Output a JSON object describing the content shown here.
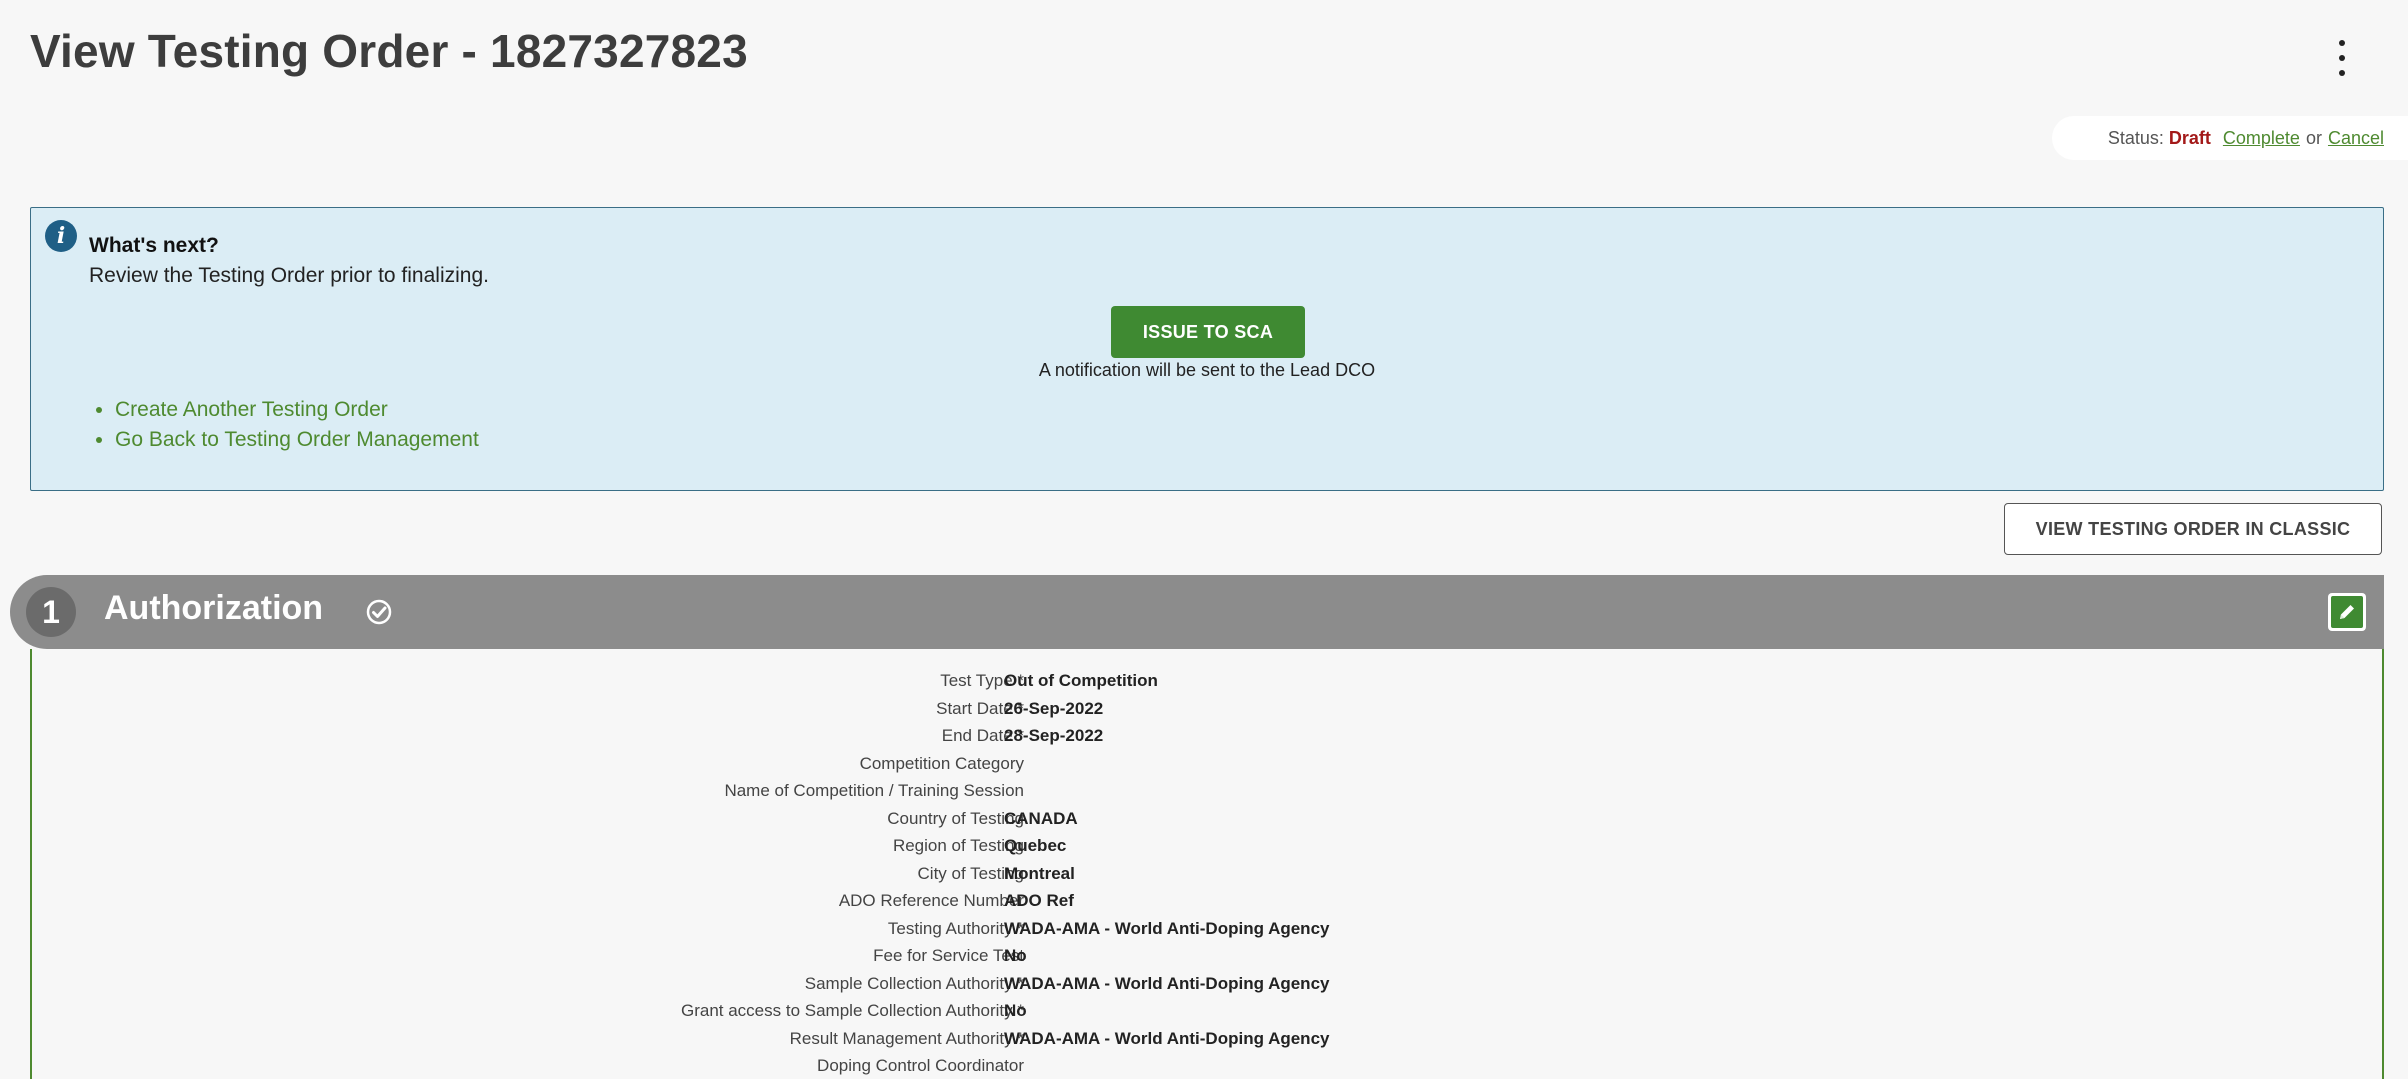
{
  "page": {
    "title": "View Testing Order - 1827327823"
  },
  "status": {
    "label": "Status:",
    "value": "Draft",
    "complete_link": "Complete",
    "or_text": "or",
    "cancel_link": "Cancel"
  },
  "info_panel": {
    "heading": "What's next?",
    "text": "Review the Testing Order prior to finalizing.",
    "issue_button": "ISSUE TO SCA",
    "notification": "A notification will be sent to the Lead DCO",
    "links": [
      "Create Another Testing Order",
      "Go Back to Testing Order Management"
    ]
  },
  "classic_button": "VIEW TESTING ORDER IN CLASSIC",
  "section": {
    "number": "1",
    "title": "Authorization",
    "fields": [
      {
        "label": "Test Type",
        "required": true,
        "value": "Out of Competition"
      },
      {
        "label": "Start Date",
        "required": true,
        "value": "26-Sep-2022"
      },
      {
        "label": "End Date",
        "required": true,
        "value": "28-Sep-2022"
      },
      {
        "label": "Competition Category",
        "required": false,
        "value": ""
      },
      {
        "label": "Name of Competition / Training Session",
        "required": false,
        "value": ""
      },
      {
        "label": "Country of Testing",
        "required": false,
        "value": "CANADA"
      },
      {
        "label": "Region of Testing",
        "required": false,
        "value": "Quebec"
      },
      {
        "label": "City of Testing",
        "required": false,
        "value": "Montreal"
      },
      {
        "label": "ADO Reference Number",
        "required": false,
        "value": "ADO Ref"
      },
      {
        "label": "Testing Authority",
        "required": true,
        "value": "WADA-AMA - World Anti-Doping Agency"
      },
      {
        "label": "Fee for Service Test",
        "required": false,
        "value": "No"
      },
      {
        "label": "Sample Collection Authority",
        "required": true,
        "value": "WADA-AMA - World Anti-Doping Agency"
      },
      {
        "label": "Grant access to Sample Collection Authority",
        "required": true,
        "value": "No"
      },
      {
        "label": "Result Management Authority",
        "required": true,
        "value": "WADA-AMA - World Anti-Doping Agency"
      },
      {
        "label": "Doping Control Coordinator",
        "required": false,
        "value": ""
      }
    ]
  },
  "colors": {
    "accent_green": "#3f8a32",
    "link_green": "#4e8a30",
    "draft_red": "#a31919",
    "info_bg": "#dbedf5",
    "section_gray": "#8c8c8c"
  },
  "icons": {
    "info": "info-icon",
    "check": "check-circle-icon",
    "edit": "pencil-icon",
    "menu": "kebab-menu-icon"
  }
}
